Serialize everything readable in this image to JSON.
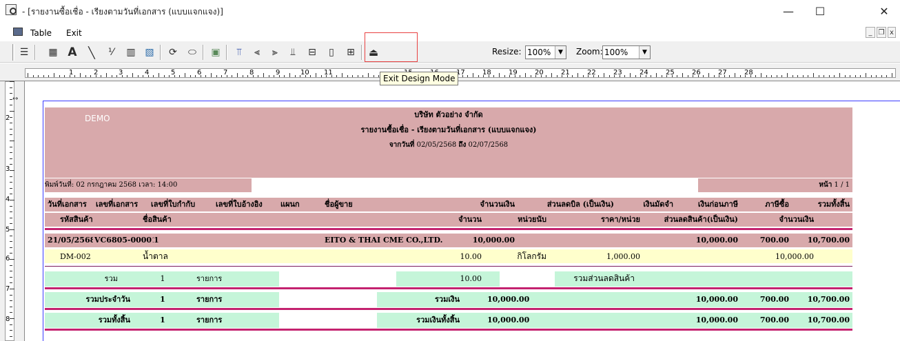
{
  "window": {
    "title": " - [รายงานซื้อเชื่อ - เรียงตามวันที่เอกสาร (แบบแจกแจง)]",
    "minimize": "—",
    "maximize": "☐",
    "close": "✕"
  },
  "menu": {
    "items": [
      "Table",
      "Exit"
    ],
    "mdi_min": "_",
    "mdi_restore": "❐",
    "mdi_close": "x"
  },
  "toolbar": {
    "resize_label": "Resize:",
    "resize_value": "100%",
    "zoom_label": "Zoom:",
    "zoom_value": "100%",
    "tooltip": "Exit Design Mode",
    "icons": [
      "align-icon",
      "grid-icon",
      "text-icon",
      "line-icon",
      "percent-icon",
      "barcode-icon",
      "image-icon",
      "rotate-icon",
      "ellipse-icon",
      "chart-icon",
      "align-top-icon",
      "align-left-icon",
      "align-right-icon",
      "align-bottom-icon",
      "hspace-icon",
      "vspace-icon",
      "size-icon",
      "exit-design-icon"
    ]
  },
  "ruler": {
    "h_numbers": [
      "1",
      "2",
      "3",
      "4",
      "5",
      "6",
      "7",
      "8",
      "9",
      "10",
      "11",
      "15",
      "16",
      "17",
      "18",
      "19",
      "20",
      "21",
      "22",
      "23",
      "24",
      "25",
      "26",
      "27",
      "28"
    ],
    "v_numbers": [
      "2",
      "3",
      "4",
      "5",
      "6",
      "7",
      "8"
    ]
  },
  "report": {
    "demo": "DEMO",
    "company": "บริษัท ตัวอย่าง จำกัด",
    "title": "รายงานซื้อเชื่อ - เรียงตามวันที่เอกสาร (แบบแจกแจง)",
    "range_label": "จากวันที่",
    "date_from": "02/05/2568",
    "range_to": "ถึง",
    "date_to": "02/07/2568",
    "print_label": "พิมพ์วันที่:",
    "print_date": "02 กรกฎาคม 2568",
    "time_label": "เวลา:",
    "print_time": "14:00",
    "page_label": "หน้า",
    "page_value": "1 / 1",
    "header1": [
      "วันที่เอกสาร",
      "เลขที่เอกสาร",
      "เลขที่ใบกำกับ",
      "เลขที่ใบอ้างอิง",
      "แผนก",
      "ชื่อผู้ขาย",
      "จำนวนเงิน",
      "ส่วนลดบิล (เป็นเงิน)",
      "เงินมัดจำ",
      "เงินก่อนภาษี",
      "ภาษีซื้อ",
      "รวมทั้งสิ้น"
    ],
    "header2": [
      "รหัสสินค้า",
      "ชื่อสินค้า",
      "จำนวน",
      "หน่วยนับ",
      "ราคา/หน่วย",
      "ส่วนลดสินค้า(เป็นเงิน)",
      "จำนวนเงิน"
    ],
    "doc_row": {
      "date": "21/05/2568",
      "doc_no": "VC6805-00001",
      "invoice": "1",
      "vendor": "EITO & THAI CME CO.,LTD.",
      "amount": "10,000.00",
      "before_tax": "10,000.00",
      "tax": "700.00",
      "total": "10,700.00"
    },
    "item_row": {
      "code": "DM-002",
      "name": "น้ำตาล",
      "qty": "10.00",
      "unit": "กิโลกรัม",
      "price": "1,000.00",
      "amount": "10,000.00"
    },
    "sum_row": {
      "label": "รวม",
      "count": "1",
      "unit": "รายการ",
      "qty": "10.00",
      "discount_label": "รวมส่วนลดสินค้า"
    },
    "daily_row": {
      "label": "รวมประจำวัน",
      "count": "1",
      "unit": "รายการ",
      "money_label": "รวมเงิน",
      "amount": "10,000.00",
      "before_tax": "10,000.00",
      "tax": "700.00",
      "total": "10,700.00"
    },
    "grand_row": {
      "label": "รวมทั้งสิ้น",
      "count": "1",
      "unit": "รายการ",
      "money_label": "รวมเงินทั้งสิ้น",
      "amount": "10,000.00",
      "before_tax": "10,000.00",
      "tax": "700.00",
      "total": "10,700.00"
    }
  }
}
